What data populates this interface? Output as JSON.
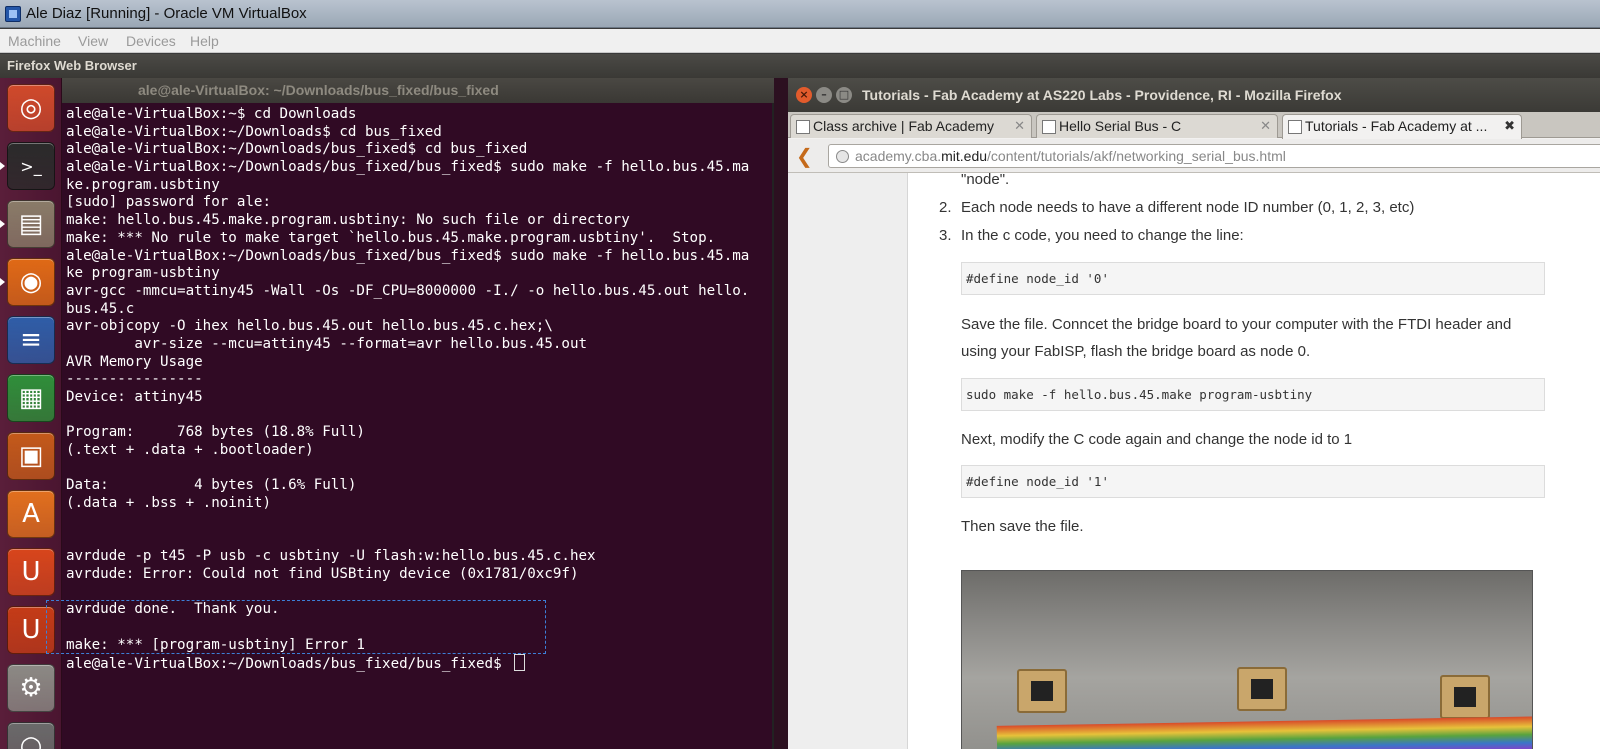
{
  "vbox": {
    "title": "Ale Diaz  [Running] - Oracle VM VirtualBox",
    "menu": [
      "Machine",
      "View",
      "Devices",
      "Help"
    ]
  },
  "ubuntu_panel": {
    "app_name": "Firefox Web Browser"
  },
  "launcher": {
    "items": [
      {
        "name": "ubuntu-dash-icon",
        "glyph": "◎",
        "color": "#d04a2b"
      },
      {
        "name": "terminal-icon",
        "glyph": ">_",
        "color": "#2b2b2b"
      },
      {
        "name": "file-manager-icon",
        "glyph": "▤",
        "color": "#8a7c69"
      },
      {
        "name": "firefox-icon",
        "glyph": "◉",
        "color": "#e06a16"
      },
      {
        "name": "writer-icon",
        "glyph": "≡",
        "color": "#2f5ea8"
      },
      {
        "name": "calc-icon",
        "glyph": "▦",
        "color": "#2f8f3a"
      },
      {
        "name": "impress-icon",
        "glyph": "▣",
        "color": "#c45a1a"
      },
      {
        "name": "software-center-icon",
        "glyph": "A",
        "color": "#e2701e"
      },
      {
        "name": "ubuntu-one-icon",
        "glyph": "U",
        "color": "#d8461c"
      },
      {
        "name": "ubuntu-one-music-icon",
        "glyph": "U",
        "color": "#c53c17"
      },
      {
        "name": "system-settings-icon",
        "glyph": "⚙",
        "color": "#8c8a85"
      },
      {
        "name": "more-icon",
        "glyph": "○",
        "color": "#6a6a6a"
      }
    ]
  },
  "terminal": {
    "title": "ale@ale-VirtualBox: ~/Downloads/bus_fixed/bus_fixed",
    "lines": [
      "ale@ale-VirtualBox:~$ cd Downloads",
      "ale@ale-VirtualBox:~/Downloads$ cd bus_fixed",
      "ale@ale-VirtualBox:~/Downloads/bus_fixed$ cd bus_fixed",
      "ale@ale-VirtualBox:~/Downloads/bus_fixed/bus_fixed$ sudo make -f hello.bus.45.ma",
      "ke.program.usbtiny",
      "[sudo] password for ale:",
      "make: hello.bus.45.make.program.usbtiny: No such file or directory",
      "make: *** No rule to make target `hello.bus.45.make.program.usbtiny'.  Stop.",
      "ale@ale-VirtualBox:~/Downloads/bus_fixed/bus_fixed$ sudo make -f hello.bus.45.ma",
      "ke program-usbtiny",
      "avr-gcc -mmcu=attiny45 -Wall -Os -DF_CPU=8000000 -I./ -o hello.bus.45.out hello.",
      "bus.45.c",
      "avr-objcopy -O ihex hello.bus.45.out hello.bus.45.c.hex;\\",
      "        avr-size --mcu=attiny45 --format=avr hello.bus.45.out",
      "AVR Memory Usage",
      "----------------",
      "Device: attiny45",
      "",
      "Program:     768 bytes (18.8% Full)",
      "(.text + .data + .bootloader)",
      "",
      "Data:          4 bytes (1.6% Full)",
      "(.data + .bss + .noinit)",
      "",
      "",
      "avrdude -p t45 -P usb -c usbtiny -U flash:w:hello.bus.45.c.hex",
      "avrdude: Error: Could not find USBtiny device (0x1781/0xc9f)",
      "",
      "avrdude done.  Thank you.",
      "",
      "make: *** [program-usbtiny] Error 1"
    ],
    "prompt": "ale@ale-VirtualBox:~/Downloads/bus_fixed/bus_fixed$ "
  },
  "firefox": {
    "title": "Tutorials - Fab Academy at AS220 Labs - Providence, RI - Mozilla Firefox",
    "tabs": [
      {
        "label": "Class archive | Fab Academy"
      },
      {
        "label": "Hello Serial Bus - C"
      },
      {
        "label": "Tutorials - Fab Academy at ..."
      }
    ],
    "url_host": "academy.cba.",
    "url_domain": "mit.edu",
    "url_path": "/content/tutorials/akf/networking_serial_bus.html",
    "page": {
      "frag_top": "\"node\".",
      "item2_num": "2.",
      "item2": "Each node needs to have a different node ID number (0, 1, 2, 3, etc)",
      "item3_num": "3.",
      "item3": "In the c code, you need to change the line:",
      "code1": "#define node_id '0'",
      "para1_line1": "Save the file. Conncet the bridge board to your computer with the FTDI header and",
      "para1_line2": "using your FabISP, flash the bridge board as node 0.",
      "code2": "sudo make -f hello.bus.45.make program-usbtiny",
      "para2": "Next, modify the C code again and change the node id to 1",
      "code3": "#define node_id '1'",
      "para3": "Then save the file."
    }
  }
}
